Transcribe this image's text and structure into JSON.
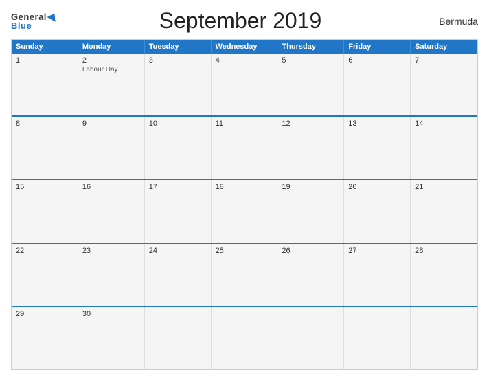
{
  "header": {
    "title": "September 2019",
    "region": "Bermuda",
    "logo_general": "General",
    "logo_blue": "Blue"
  },
  "calendar": {
    "days_of_week": [
      "Sunday",
      "Monday",
      "Tuesday",
      "Wednesday",
      "Thursday",
      "Friday",
      "Saturday"
    ],
    "weeks": [
      [
        {
          "day": "1",
          "event": ""
        },
        {
          "day": "2",
          "event": "Labour Day"
        },
        {
          "day": "3",
          "event": ""
        },
        {
          "day": "4",
          "event": ""
        },
        {
          "day": "5",
          "event": ""
        },
        {
          "day": "6",
          "event": ""
        },
        {
          "day": "7",
          "event": ""
        }
      ],
      [
        {
          "day": "8",
          "event": ""
        },
        {
          "day": "9",
          "event": ""
        },
        {
          "day": "10",
          "event": ""
        },
        {
          "day": "11",
          "event": ""
        },
        {
          "day": "12",
          "event": ""
        },
        {
          "day": "13",
          "event": ""
        },
        {
          "day": "14",
          "event": ""
        }
      ],
      [
        {
          "day": "15",
          "event": ""
        },
        {
          "day": "16",
          "event": ""
        },
        {
          "day": "17",
          "event": ""
        },
        {
          "day": "18",
          "event": ""
        },
        {
          "day": "19",
          "event": ""
        },
        {
          "day": "20",
          "event": ""
        },
        {
          "day": "21",
          "event": ""
        }
      ],
      [
        {
          "day": "22",
          "event": ""
        },
        {
          "day": "23",
          "event": ""
        },
        {
          "day": "24",
          "event": ""
        },
        {
          "day": "25",
          "event": ""
        },
        {
          "day": "26",
          "event": ""
        },
        {
          "day": "27",
          "event": ""
        },
        {
          "day": "28",
          "event": ""
        }
      ],
      [
        {
          "day": "29",
          "event": ""
        },
        {
          "day": "30",
          "event": ""
        },
        {
          "day": "",
          "event": ""
        },
        {
          "day": "",
          "event": ""
        },
        {
          "day": "",
          "event": ""
        },
        {
          "day": "",
          "event": ""
        },
        {
          "day": "",
          "event": ""
        }
      ]
    ]
  }
}
